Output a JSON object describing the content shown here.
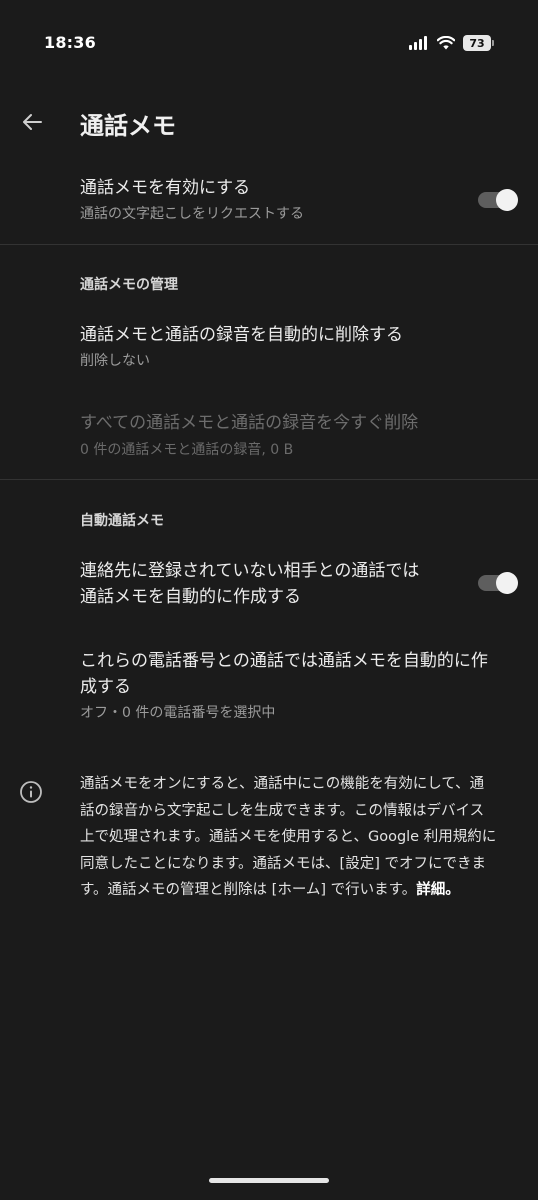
{
  "status_bar": {
    "time": "18:36",
    "battery_level": "73"
  },
  "app_bar": {
    "title": "通話メモ"
  },
  "enable_memo": {
    "title": "通話メモを有効にする",
    "subtitle": "通話の文字起こしをリクエストする",
    "toggle_on": true
  },
  "management": {
    "header": "通話メモの管理",
    "auto_delete": {
      "title": "通話メモと通話の録音を自動的に削除する",
      "subtitle": "削除しない"
    },
    "delete_all": {
      "title": "すべての通話メモと通話の録音を今すぐ削除",
      "subtitle": "0 件の通話メモと通話の録音, 0 B",
      "enabled": false
    }
  },
  "auto_memo": {
    "header": "自動通話メモ",
    "unknown_callers": {
      "title_line1": "連絡先に登録されていない相手との通話では",
      "title_line2": "通話メモを自動的に作成する",
      "toggle_on": true
    },
    "selected_numbers": {
      "title_line1": "これらの電話番号との通話では通話メモを自動的に作",
      "title_line2": "成する",
      "subtitle": "オフ・0 件の電話番号を選択中"
    }
  },
  "info": {
    "line1": "通話メモをオンにすると、通話中にこの機能を有効にして、通",
    "line2": "話の録音から文字起こしを生成できます。この情報はデバイス",
    "line3": "上で処理されます。通話メモを使用すると、Google 利用規約に",
    "line4": "同意したことになります。通話メモは、[設定] でオフにできま",
    "line5_text": "す。通話メモの管理と削除は [ホーム] で行います。",
    "link": "詳細。"
  },
  "colors": {
    "background": "#1b1b1b",
    "toggle_track": "#5e5e5e",
    "toggle_thumb": "#f2f2f2"
  },
  "icons": {
    "back": "arrow-left-icon",
    "info": "info-circle-icon",
    "signal": "cell-signal-icon",
    "wifi": "wifi-icon",
    "battery": "battery-icon"
  }
}
